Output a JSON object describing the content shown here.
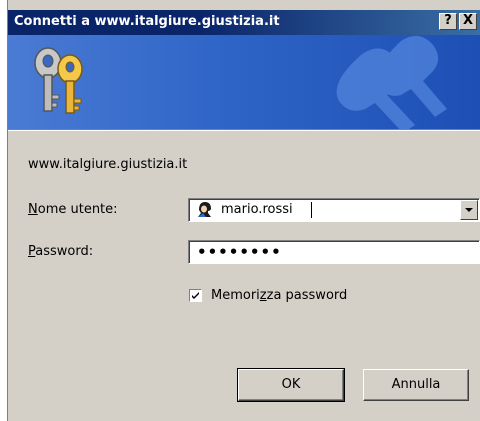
{
  "window": {
    "title": "Connetti a www.italgiure.giustizia.it",
    "help_button": "?",
    "close_button": "X"
  },
  "dialog": {
    "site": "www.italgiure.giustizia.it",
    "username_label_first": "N",
    "username_label_rest": "ome utente:",
    "username_value": "mario.rossi",
    "password_label_first": "P",
    "password_label_rest": "assword:",
    "password_masked": "••••••••",
    "remember_label_before": "Memori",
    "remember_label_underlined": "z",
    "remember_label_after": "za password",
    "remember_checked": true
  },
  "buttons": {
    "ok": "OK",
    "cancel": "Annulla"
  },
  "colors": {
    "titlebar": "#0a246a",
    "banner": "#2f65c7",
    "face": "#d4d0c8"
  }
}
